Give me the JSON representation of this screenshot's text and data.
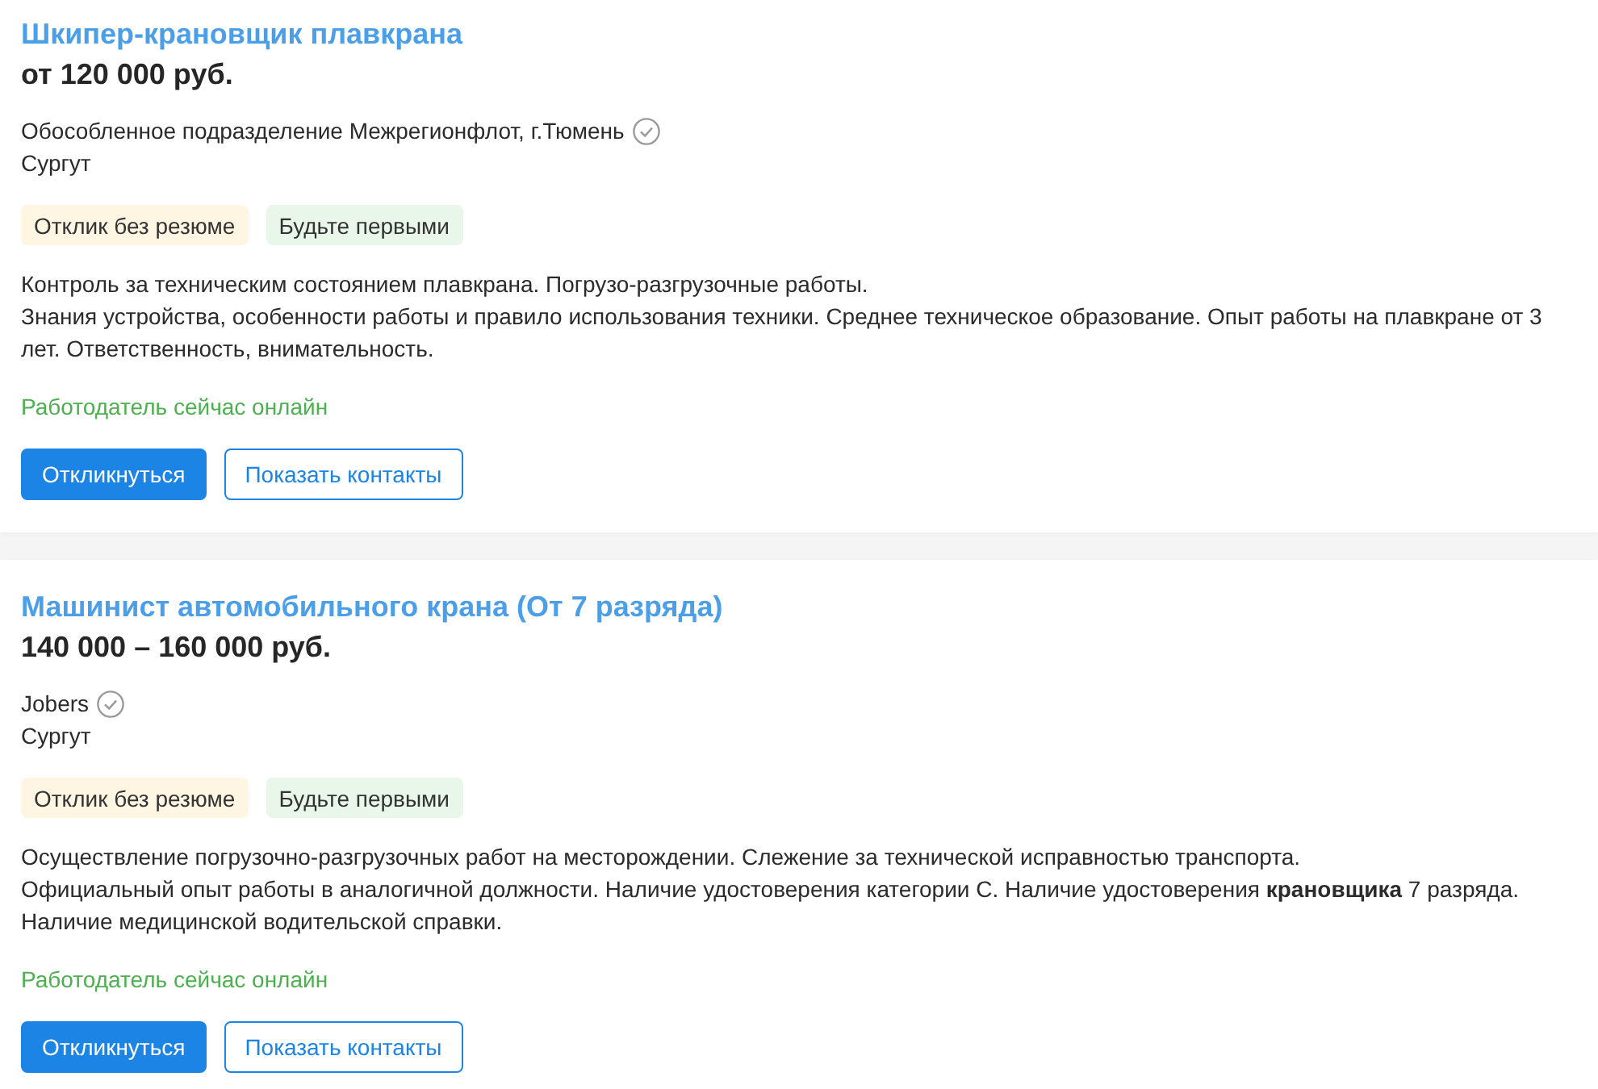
{
  "vacancies": [
    {
      "title": "Шкипер-крановщик плавкрана",
      "salary": "от 120 000 руб.",
      "employer": {
        "name": "Обособленное подразделение Межрегионфлот, г.Тюмень",
        "verified": true
      },
      "city": "Сургут",
      "tags": [
        {
          "label": "Отклик без резюме",
          "color": "#fef6e3"
        },
        {
          "label": "Будьте первыми",
          "color": "#e9f7ea"
        }
      ],
      "description": [
        "Контроль за техническим состоянием плавкрана. Погрузо-разгрузочные работы.",
        "Знания устройства, особенности работы и правило использования техники. Среднее техническое образование. Опыт работы на плавкране от 3 лет. Ответственность, внимательность."
      ],
      "online": "Работодатель сейчас онлайн",
      "buttons": [
        {
          "label": "Откликнуться",
          "kind": "primary"
        },
        {
          "label": "Показать контакты",
          "kind": "secondary"
        }
      ]
    },
    {
      "title": "Машинист автомобильного крана (От 7 разряда)",
      "salary": "140 000 – 160 000 руб.",
      "employer": {
        "name": "Jobers",
        "verified": true
      },
      "city": "Сургут",
      "tags": [
        {
          "label": "Отклик без резюме",
          "color": "#fef6e3"
        },
        {
          "label": "Будьте первыми",
          "color": "#e9f7ea"
        }
      ],
      "description": [
        "Осуществление погрузочно-разгрузочных работ на месторождении. Слежение за технической исправностью транспорта.",
        "Официальный опыт работы в аналогичной должности. Наличие удостоверения категории С. Наличие удостоверения **крановщика** 7 разряда. Наличие медицинской водительской справки."
      ],
      "online": "Работодатель сейчас онлайн",
      "buttons": [
        {
          "label": "Откликнуться",
          "kind": "primary"
        },
        {
          "label": "Показать контакты",
          "kind": "secondary"
        }
      ]
    }
  ]
}
